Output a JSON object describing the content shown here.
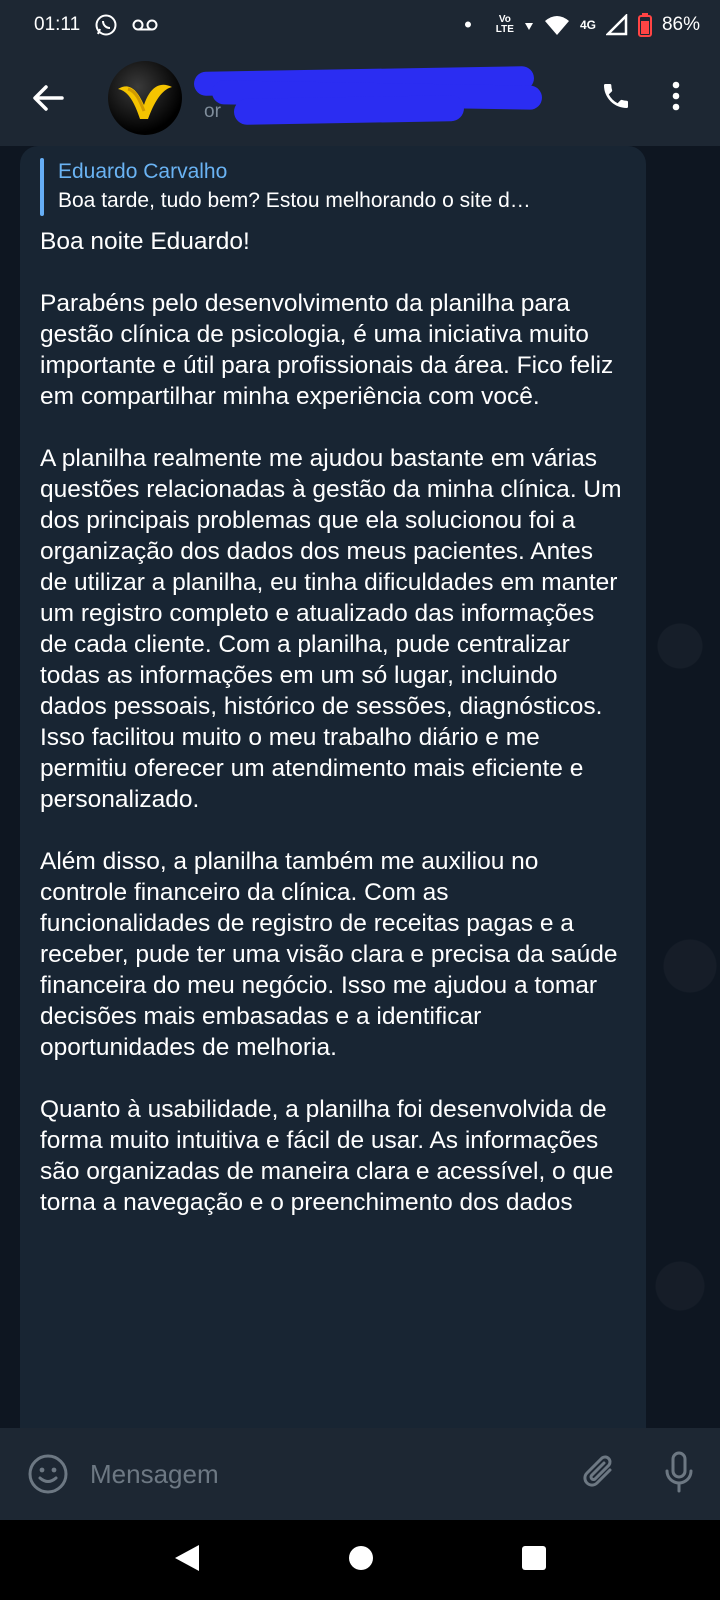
{
  "status_bar": {
    "time": "01:11",
    "left_icons": [
      "whatsapp-icon",
      "voicemail-icon"
    ],
    "dot": "•",
    "volte_top": "Vo",
    "volte_bottom": "LTE",
    "network": "4G",
    "battery": "86%",
    "battery_level": 0.86
  },
  "header": {
    "contact_name": "",
    "contact_status_visible": "or",
    "name_redacted": true
  },
  "message": {
    "reply": {
      "author": "Eduardo Carvalho",
      "text": "Boa tarde, tudo bem?   Estou melhorando o site d…"
    },
    "paragraphs": [
      "Boa noite Eduardo!",
      "Parabéns pelo desenvolvimento da planilha para gestão clínica de psicologia, é uma iniciativa muito importante e útil para profissionais da área. Fico feliz em compartilhar minha experiência com você.",
      "A planilha realmente me ajudou bastante em várias questões relacionadas à gestão da minha clínica. Um dos principais problemas que ela solucionou foi a organização dos dados dos meus pacientes. Antes de utilizar a planilha, eu tinha dificuldades em manter um registro completo e atualizado das informações de cada cliente. Com a planilha, pude centralizar todas as informações em um só lugar, incluindo dados pessoais, histórico de sessões, diagnósticos. Isso facilitou muito o meu trabalho diário e me permitiu oferecer um atendimento mais eficiente e personalizado.",
      "Além disso, a planilha também me auxiliou no controle financeiro da clínica. Com as funcionalidades de registro de receitas pagas e a receber, pude ter uma visão clara e precisa da saúde financeira do meu negócio. Isso me ajudou a tomar decisões mais embasadas e a identificar oportunidades de melhoria.",
      "Quanto à usabilidade, a planilha foi desenvolvida de forma muito intuitiva e fácil de usar. As informações são organizadas de maneira clara e acessível, o que torna a navegação e o preenchimento dos dados"
    ]
  },
  "input": {
    "placeholder": "Mensagem"
  },
  "colors": {
    "header_bg": "#1d2733",
    "bubble_bg": "#182533",
    "accent": "#6ab3f3"
  }
}
